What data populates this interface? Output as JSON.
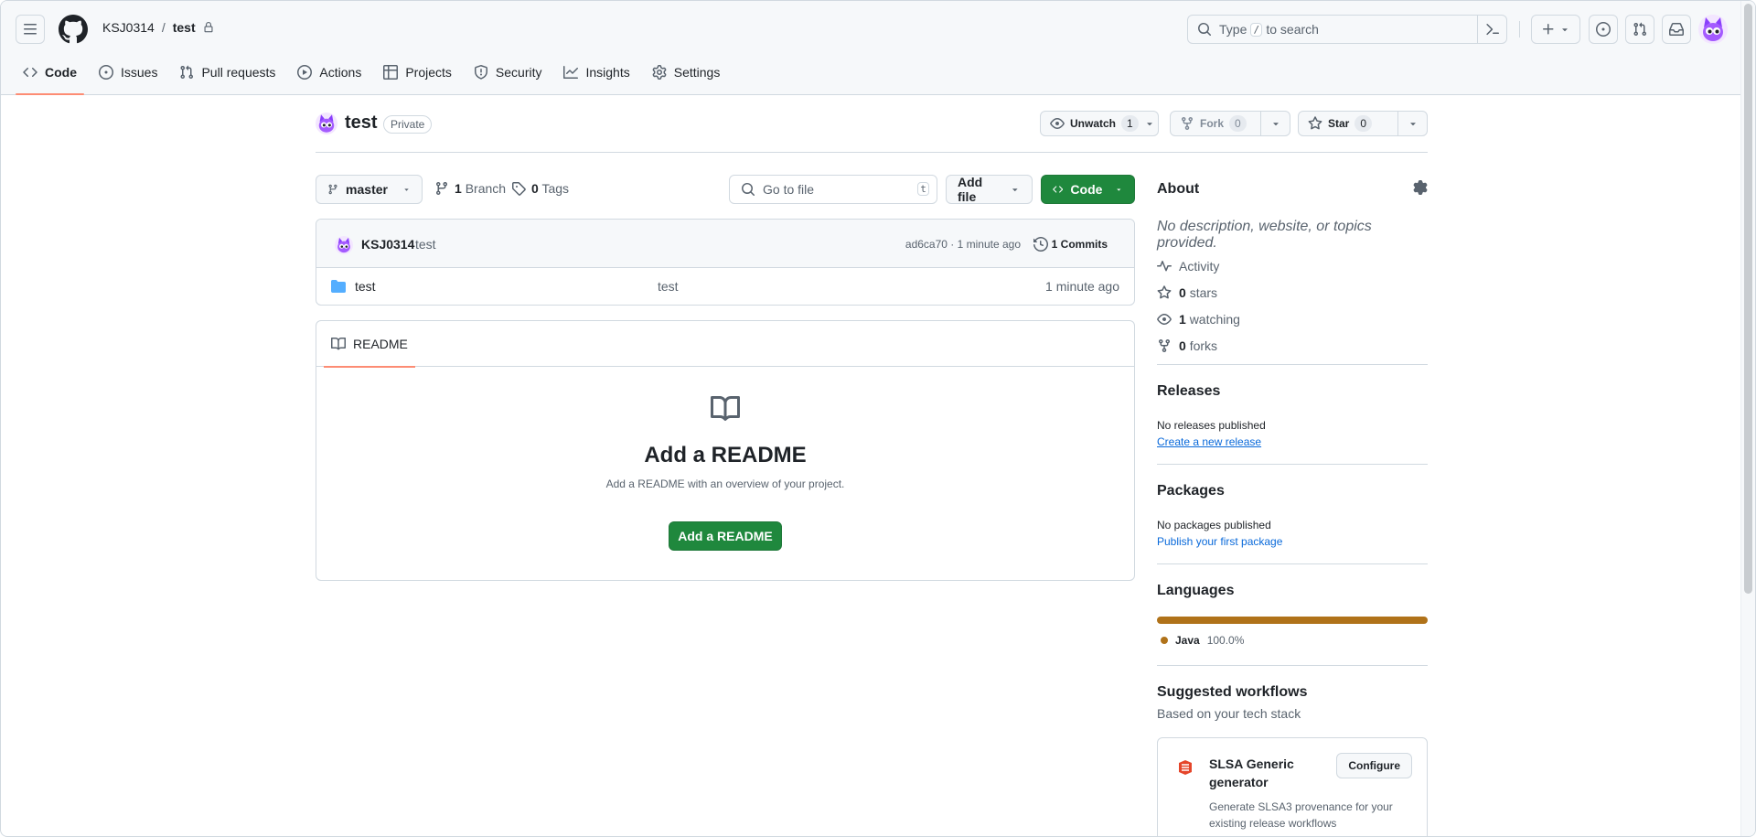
{
  "header": {
    "owner": "KSJ0314",
    "separator": "/",
    "repo": "test",
    "search": {
      "prefix": "Type",
      "key": "/",
      "suffix": "to search"
    }
  },
  "nav": {
    "tabs": [
      {
        "label": "Code",
        "icon": "code-icon",
        "active": true
      },
      {
        "label": "Issues",
        "icon": "issue-icon"
      },
      {
        "label": "Pull requests",
        "icon": "pull-request-icon"
      },
      {
        "label": "Actions",
        "icon": "play-icon"
      },
      {
        "label": "Projects",
        "icon": "table-icon"
      },
      {
        "label": "Security",
        "icon": "shield-icon"
      },
      {
        "label": "Insights",
        "icon": "graph-icon"
      },
      {
        "label": "Settings",
        "icon": "gear-icon"
      }
    ]
  },
  "repo": {
    "name": "test",
    "visibility": "Private",
    "watch": {
      "label": "Unwatch",
      "count": "1"
    },
    "fork": {
      "label": "Fork",
      "count": "0"
    },
    "star": {
      "label": "Star",
      "count": "0"
    }
  },
  "toolbar": {
    "branch": "master",
    "branches": {
      "count": "1",
      "label": "Branch"
    },
    "tags": {
      "count": "0",
      "label": "Tags"
    },
    "goto_placeholder": "Go to file",
    "goto_key": "t",
    "add_file": "Add file",
    "code": "Code"
  },
  "commit": {
    "author": "KSJ0314",
    "message": "test",
    "meta": "ad6ca70 · 1 minute ago",
    "commits": "1 Commits"
  },
  "files": [
    {
      "name": "test",
      "message": "test",
      "time": "1 minute ago",
      "type": "folder"
    }
  ],
  "readme": {
    "tab": "README",
    "title": "Add a README",
    "subtitle": "Add a README with an overview of your project.",
    "button": "Add a README"
  },
  "about": {
    "title": "About",
    "description": "No description, website, or topics provided.",
    "stats": [
      {
        "icon": "pulse-icon",
        "value": "",
        "label": "Activity"
      },
      {
        "icon": "star-icon",
        "value": "0",
        "label": "stars"
      },
      {
        "icon": "eye-icon",
        "value": "1",
        "label": "watching"
      },
      {
        "icon": "fork-icon",
        "value": "0",
        "label": "forks"
      }
    ]
  },
  "releases": {
    "title": "Releases",
    "empty": "No releases published",
    "link": "Create a new release"
  },
  "packages": {
    "title": "Packages",
    "empty": "No packages published",
    "link": "Publish your first package"
  },
  "languages": {
    "title": "Languages",
    "items": [
      {
        "name": "Java",
        "percent": "100.0%",
        "color": "#b07219",
        "share": 1.0
      }
    ]
  },
  "workflows": {
    "title": "Suggested workflows",
    "subtitle": "Based on your tech stack",
    "card": {
      "title": "SLSA Generic generator",
      "button": "Configure",
      "description": "Generate SLSA3 provenance for your existing release workflows"
    }
  },
  "colors": {
    "accent": "#1f883d",
    "tab_underline": "#fd8c73",
    "link": "#0969da",
    "java": "#b07219"
  }
}
